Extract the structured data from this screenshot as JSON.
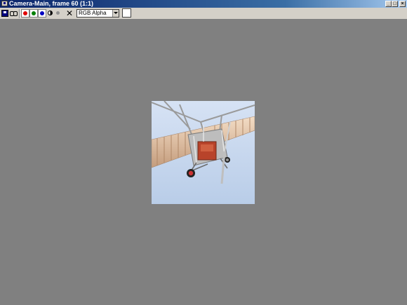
{
  "window": {
    "title": "Camera-Main, frame 60 (1:1)",
    "controls": {
      "minimize": "_",
      "maximize": "□",
      "close": "×"
    }
  },
  "toolbar": {
    "buttons": [
      {
        "name": "save-image",
        "icon": "floppy-disk-icon"
      },
      {
        "name": "clone-window",
        "icon": "clone-icon"
      },
      {
        "name": "red-channel",
        "icon": "red-dot-icon",
        "color": "#e00000"
      },
      {
        "name": "green-channel",
        "icon": "green-dot-icon",
        "color": "#008000"
      },
      {
        "name": "blue-channel",
        "icon": "blue-dot-icon",
        "color": "#0000c0"
      },
      {
        "name": "monochrome",
        "icon": "half-circle-icon"
      },
      {
        "name": "alpha",
        "icon": "gray-dot-icon",
        "color": "#909090"
      },
      {
        "name": "clear",
        "icon": "x-icon"
      }
    ],
    "channel_select": {
      "value": "RGB Alpha"
    },
    "color_swatch": {
      "color": "#ffffff"
    }
  },
  "viewport": {
    "background": "#808080",
    "image": {
      "subject": "rendered biplane",
      "sky_color": "#c6d8f0"
    }
  }
}
